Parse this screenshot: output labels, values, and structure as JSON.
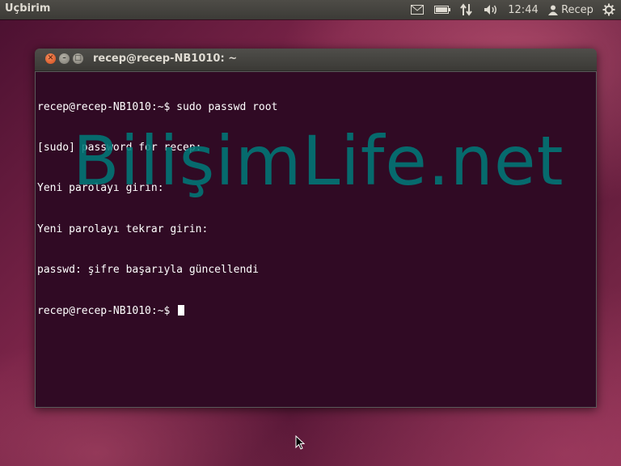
{
  "panel": {
    "app_name": "Uçbirim",
    "clock": "12:44",
    "user": "Recep",
    "icons": [
      "mail-icon",
      "battery-icon",
      "network-icon",
      "volume-icon",
      "user-icon",
      "gear-icon"
    ]
  },
  "window": {
    "title": "recep@recep-NB1010: ~",
    "buttons": [
      "close-button",
      "minimize-button",
      "maximize-button"
    ]
  },
  "terminal": {
    "lines": [
      "recep@recep-NB1010:~$ sudo passwd root",
      "[sudo] password for recep:",
      "Yeni parolayı girin:",
      "Yeni parolayı tekrar girin:",
      "passwd: şifre başarıyla güncellendi",
      "recep@recep-NB1010:~$ "
    ],
    "background": "#300a24",
    "foreground": "#ffffff"
  },
  "watermark": "BilişimLife.net"
}
